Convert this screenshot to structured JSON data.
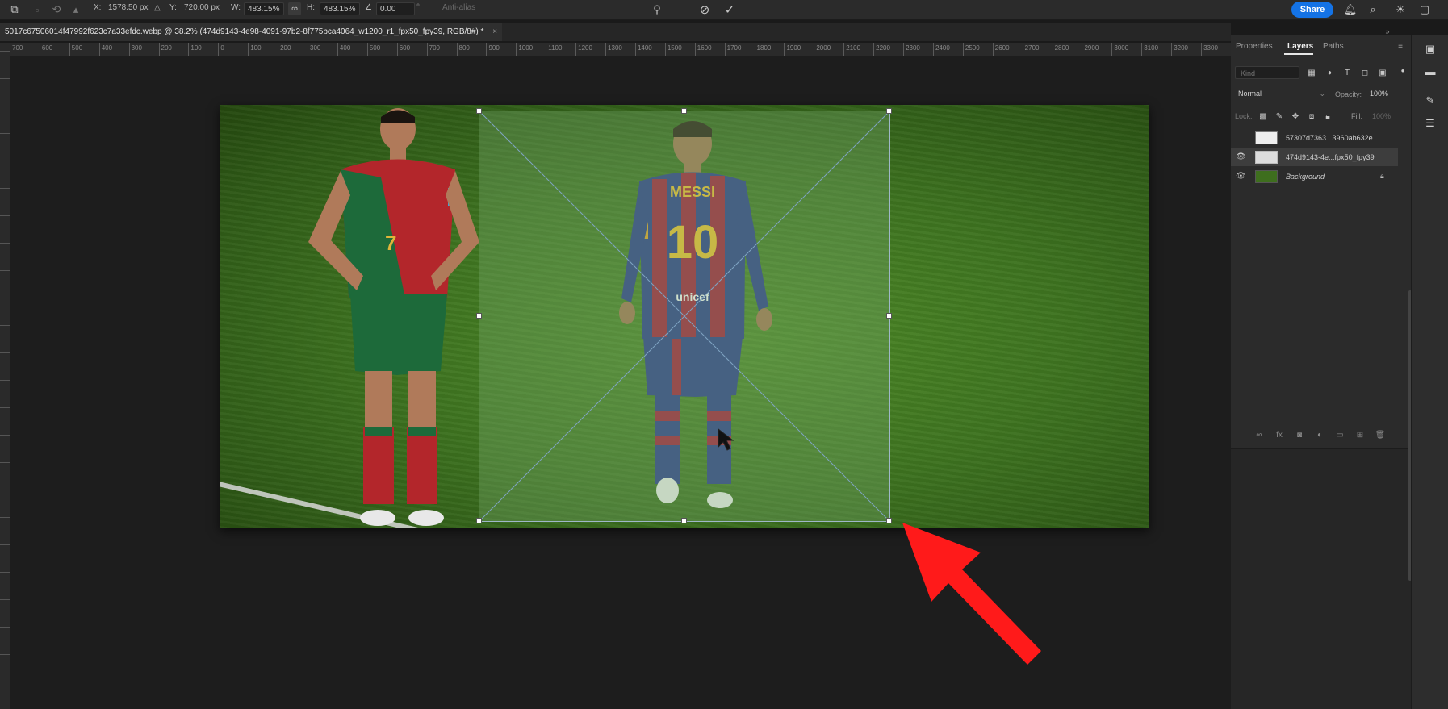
{
  "options_bar": {
    "x_label": "X:",
    "x_value": "1578.50 px",
    "y_label": "Y:",
    "y_value": "720.00 px",
    "w_label": "W:",
    "w_value": "483.15%",
    "h_label": "H:",
    "h_value": "483.15%",
    "angle_value": "0.00",
    "antialias_label": "Anti-alias",
    "share_label": "Share"
  },
  "document": {
    "tab_title": "5017c67506014f47992f623c7a33efdc.webp @ 38.2% (474d9143-4e98-4091-97b2-8f775bca4064_w1200_r1_fpx50_fpy39, RGB/8#) *",
    "close_glyph": "×"
  },
  "ruler": {
    "numbers": [
      "700",
      "600",
      "500",
      "400",
      "300",
      "200",
      "100",
      "0",
      "100",
      "200",
      "300",
      "400",
      "500",
      "600",
      "700",
      "800",
      "900",
      "1000",
      "1100",
      "1200",
      "1300",
      "1400",
      "1500",
      "1600",
      "1700",
      "1800",
      "1900",
      "2000",
      "2100",
      "2200",
      "2300",
      "2400",
      "2500",
      "2600",
      "2700",
      "2800",
      "2900",
      "3000",
      "3100",
      "3200",
      "3300"
    ]
  },
  "panel": {
    "tabs": [
      "Properties",
      "Layers",
      "Paths"
    ],
    "active_tab": "Layers",
    "search_placeholder": "Kind",
    "blend_mode": "Normal",
    "opacity_label": "Opacity:",
    "opacity_value": "100%",
    "lock_label": "Lock:",
    "fill_label": "Fill:",
    "fill_value": "100%",
    "layers": [
      {
        "name": "57307d7363...3960ab632e",
        "visible": false,
        "italic": false
      },
      {
        "name": "474d9143-4e...fpx50_fpy39",
        "visible": true,
        "italic": false,
        "selected": true
      },
      {
        "name": "Background",
        "visible": true,
        "italic": true,
        "locked": true
      }
    ]
  },
  "image_content": {
    "player_right_name": "MESSI",
    "player_right_number": "10",
    "sponsor": "unicef",
    "player_left_number": "7"
  },
  "colors": {
    "accent": "#1473e6",
    "arrow": "#ff1a1a"
  }
}
